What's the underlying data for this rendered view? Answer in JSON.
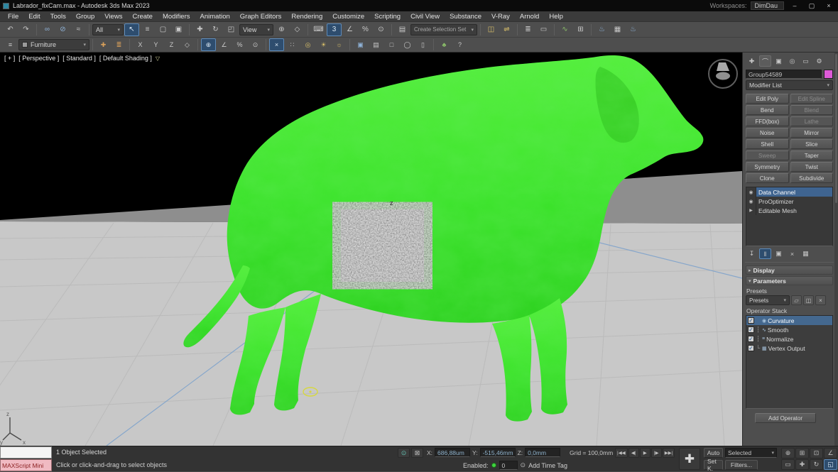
{
  "titlebar": {
    "title": "Labrador_fixCam.max - Autodesk 3ds Max 2023",
    "workspaces_label": "Workspaces:",
    "workspace_value": "DimDau"
  },
  "menubar": {
    "items": [
      "File",
      "Edit",
      "Tools",
      "Group",
      "Views",
      "Create",
      "Modifiers",
      "Animation",
      "Graph Editors",
      "Rendering",
      "Customize",
      "Scripting",
      "Civil View",
      "Substance",
      "V-Ray",
      "Arnold",
      "Help"
    ]
  },
  "toolbar1": {
    "selection_filter_value": "All",
    "ref_coord_value": "View",
    "named_sets_value": "Create Selection Set"
  },
  "toolbar2": {
    "layer_value": "Furniture"
  },
  "viewport": {
    "label_plus": "[ + ]",
    "label_camera": "[ Perspective ]",
    "label_renderer": "[ Standard ]",
    "label_shading": "[ Default Shading ]",
    "axis_z": "z",
    "tripod_x": "x",
    "tripod_y": "y",
    "tripod_z": "z"
  },
  "command_panel": {
    "object_name": "Group54589",
    "modifier_list_label": "Modifier List",
    "modifier_buttons": [
      {
        "label": "Edit Poly"
      },
      {
        "label": "Edit Spline"
      },
      {
        "label": "Bend"
      },
      {
        "label": "Blend"
      },
      {
        "label": "FFD(box)"
      },
      {
        "label": "Lathe"
      },
      {
        "label": "Noise"
      },
      {
        "label": "Mirror"
      },
      {
        "label": "Shell"
      },
      {
        "label": "Slice"
      },
      {
        "label": "Sweep"
      },
      {
        "label": "Taper"
      },
      {
        "label": "Symmetry"
      },
      {
        "label": "Twist"
      },
      {
        "label": "Clone"
      },
      {
        "label": "Subdivide"
      }
    ],
    "stack_items": [
      {
        "label": "Data Channel"
      },
      {
        "label": "ProOptimizer"
      },
      {
        "label": "Editable Mesh"
      }
    ],
    "display_rollout": "Display",
    "parameters_rollout": "Parameters",
    "presets_label": "Presets",
    "presets_value": "Presets",
    "operator_stack_label": "Operator Stack",
    "operators": [
      {
        "label": "Curvature"
      },
      {
        "label": "Smooth"
      },
      {
        "label": "Normalize"
      },
      {
        "label": "Vertex Output"
      }
    ],
    "add_operator_label": "Add Operator"
  },
  "statusbar": {
    "maxscript_label": "MAXScript Mini",
    "selection_text": "1 Object Selected",
    "prompt_text": "Click or click-and-drag to select objects",
    "x_label": "X:",
    "x_value": "686,88um",
    "y_label": "Y:",
    "y_value": "-515,46mm",
    "z_label": "Z:",
    "z_value": "0,0mm",
    "grid_text": "Grid = 100,0mm",
    "enabled_label": "Enabled:",
    "frame_value": "0",
    "add_time_tag": "Add Time Tag",
    "auto_label": "Auto",
    "selected_value": "Selected",
    "set_key_label": "Set K.",
    "filters_label": "Filters..."
  },
  "colors": {
    "accent_blue": "#3c78b4",
    "dog_green": "#3be32a",
    "swatch_magenta": "#de5ad8",
    "maxscript_pink": "#f0bac2"
  },
  "icons": {
    "undo": "↶",
    "redo": "↷",
    "link": "∞",
    "unlink": "⊘",
    "bind": "≈",
    "select": "↖",
    "select_by_name": "≡",
    "region": "▢",
    "crossing": "▣",
    "move": "✚",
    "rotate": "↻",
    "scale": "◰",
    "pivot": "⊕",
    "manipulate": "◇",
    "kbd": "⌨",
    "snap": "3",
    "angle_snap": "∠",
    "percent_snap": "%",
    "spinner_snap": "⊙",
    "named_sets": "▤",
    "mirror": "◫",
    "align": "⇌",
    "layers": "≣",
    "ribbon": "▭",
    "curve_editor": "∿",
    "schematic": "⊞",
    "render_setup": "♨",
    "render_frame": "▦",
    "render": "♨",
    "arrow_down": "▾",
    "arrow_right": "▸",
    "explorer": "≡",
    "new_layer": "✚",
    "manage_layers": "≣",
    "axis_x": "X",
    "axis_y": "Y",
    "axis_z": "Z",
    "axis_plane": "◇",
    "center": "⊕",
    "xview": "×",
    "dots": "∷",
    "bulb": "◎",
    "sun": "☀",
    "shade": "☼",
    "camera": "▣",
    "film": "▤",
    "box": "□",
    "torus": "◯",
    "tube": "▯",
    "tree": "♣",
    "help": "?",
    "eye": "◉",
    "expand": "▶",
    "tab_create": "✚",
    "tab_modify": "⌒",
    "tab_hierarchy": "▣",
    "tab_motion": "◎",
    "tab_display": "▭",
    "tab_utilities": "⚙",
    "pin": "↧",
    "end_result": "‖",
    "unique": "▣",
    "remove": "×",
    "config": "▦",
    "folder": "▱",
    "save": "◫",
    "del": "×",
    "check": "✓",
    "branch": "┆",
    "corner": "└",
    "op_curvature": "◉",
    "op_smooth": "∿",
    "op_normalize": "≡",
    "op_vertex": "▦",
    "lock": "⊠",
    "isolate": "⊙",
    "t_start": "|◀◀",
    "t_prev": "◀|",
    "t_play": "▶",
    "t_next": "|▶",
    "t_end": "▶▶|",
    "big_key": "✚",
    "clock": "⊙",
    "green_dot": "●",
    "zoom": "⊕",
    "zoom_all": "⊞",
    "zoom_ext": "⊡",
    "fov": "∠",
    "zoom_reg": "▭",
    "pan": "✚",
    "orbit": "↻",
    "maxi": "◱",
    "min": "–",
    "max": "▢",
    "close": "×",
    "funnel": "▽"
  }
}
